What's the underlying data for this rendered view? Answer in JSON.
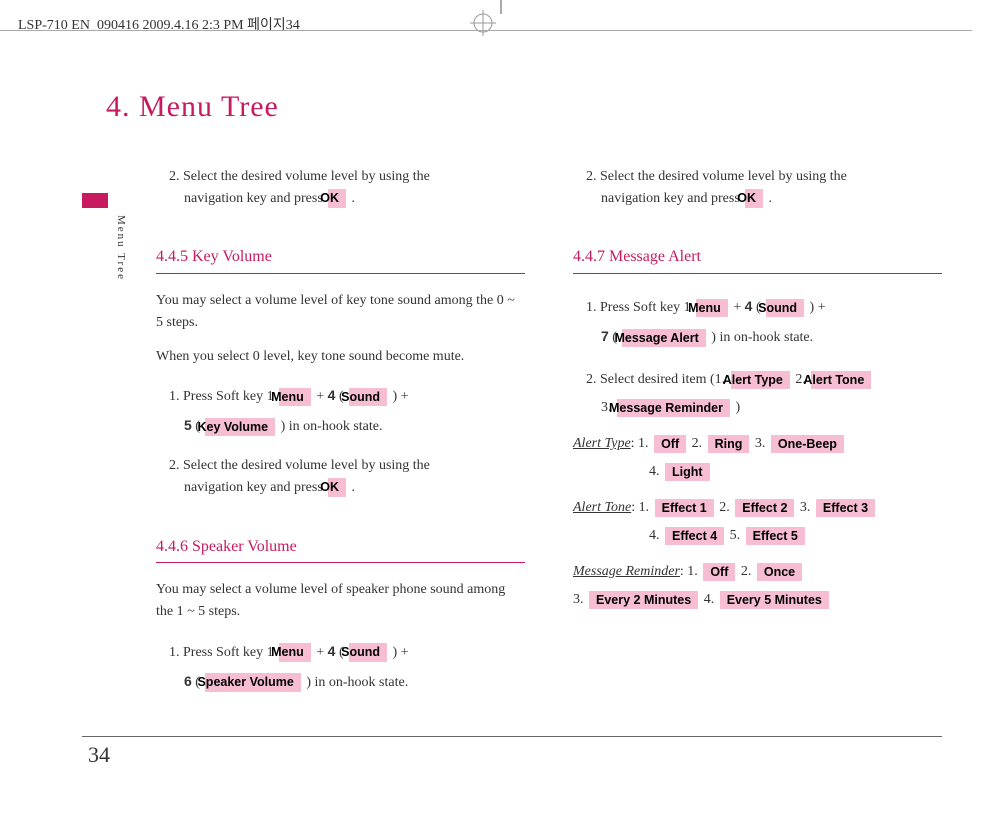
{
  "cropline": "LSP-710 EN_090416  2009.4.16 2:3 PM  페이지34",
  "side_tab_text": "Menu Tree",
  "chapter_title": "4. Menu Tree",
  "page_number": "34",
  "buttons": {
    "ok": "OK",
    "menu": "Menu",
    "sound": "Sound",
    "key_volume": "Key Volume",
    "speaker_volume": "Speaker Volume",
    "message_alert": "Message Alert",
    "alert_type": "Alert Type",
    "alert_tone": "Alert Tone",
    "message_reminder": "Message Reminder",
    "off": "Off",
    "ring": "Ring",
    "one_beep": "One-Beep",
    "light": "Light",
    "effect1": "Effect 1",
    "effect2": "Effect 2",
    "effect3": "Effect 3",
    "effect4": "Effect 4",
    "effect5": "Effect 5",
    "once": "Once",
    "every2": "Every 2 Minutes",
    "every5": "Every 5 Minutes"
  },
  "left": {
    "step2a": "2. Select the desired volume level by using the",
    "step2b": "navigation key and press ",
    "step2c": " .",
    "s445_head": "4.4.5 Key Volume",
    "s445_p1": "You may select a volume level of key tone sound among the 0 ~ 5 steps.",
    "s445_p2": "When you select 0 level, key tone sound become mute.",
    "s445_step1_a": "1. Press Soft key 1 ",
    "plus": " + ",
    "num4": "4",
    "open": "( ",
    "close": " )",
    "plus2": " +",
    "num5": "5",
    "s445_step1_b": " in on-hook state.",
    "s445_step2a": "2. Select the desired volume level by using the",
    "s445_step2b": "navigation key and press ",
    "s446_head": "4.4.6 Speaker Volume",
    "s446_p1": "You may select a volume level of speaker phone sound among the 1 ~ 5 steps.",
    "s446_step1_a": "1. Press Soft key 1 ",
    "num6": "6",
    "s446_step1_b": " in on-hook state."
  },
  "right": {
    "step2a": "2. Select the desired volume level by using the",
    "step2b": "navigation key and press ",
    "step2c": " .",
    "s447_head": "4.4.7 Message Alert",
    "s1a": "1. Press Soft key 1 ",
    "num7": "7",
    "s1b": " in on-hook state.",
    "s2a": "2. Select desired item (1. ",
    "s2b": "  2. ",
    "s2c": "3. ",
    "s2d": " )",
    "atype_label": "Alert Type",
    "atone_label": "Alert Tone",
    "mrem_label": "Message Reminder",
    "enum": ": 1. ",
    "e2": "  2. ",
    "e3": "  3. ",
    "e4": "4. ",
    "e5": "  5. ",
    "mr1": ":  1. ",
    "mr2": "  2. ",
    "mr3": "3. ",
    "mr4": "  4. "
  }
}
